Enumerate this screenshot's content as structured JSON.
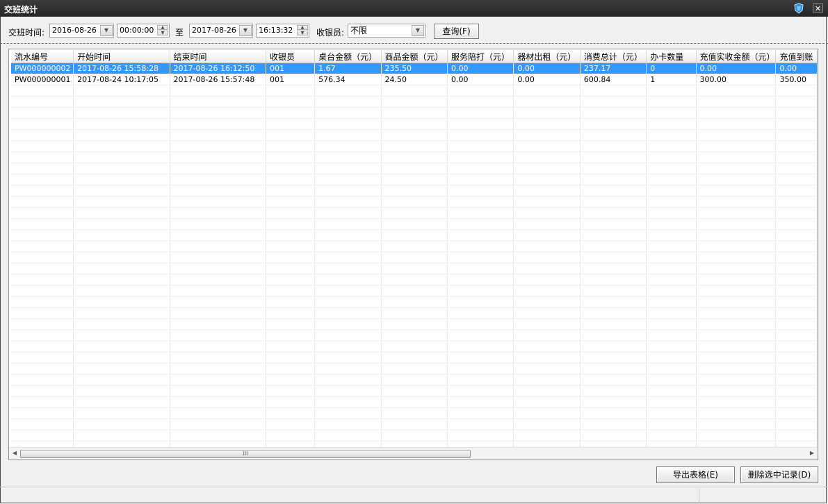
{
  "window": {
    "title": "交班统计",
    "icon": "app-shield-icon",
    "close_label": "✕"
  },
  "filters": {
    "date_label": "交班时间:",
    "start_date": "2016-08-26",
    "start_time": "00:00:00",
    "to_label": "至",
    "end_date": "2017-08-26",
    "end_time": "16:13:32",
    "cashier_label": "收银员:",
    "cashier_value": "不限",
    "query_button": "查询(F)"
  },
  "table": {
    "columns": [
      "流水编号",
      "开始时间",
      "结束时间",
      "收银员",
      "桌台金额（元）",
      "商品金额（元）",
      "服务陪打（元）",
      "器材出租（元）",
      "消费总计（元）",
      "办卡数量",
      "充值实收金额（元）",
      "充值到账"
    ],
    "rows": [
      [
        "PW000000002",
        "2017-08-26 15:58:28",
        "2017-08-26 16:12:50",
        "001",
        "1.67",
        "235.50",
        "0.00",
        "0.00",
        "237.17",
        "0",
        "0.00",
        "0.00"
      ],
      [
        "PW000000001",
        "2017-08-24 10:17:05",
        "2017-08-26 15:57:48",
        "001",
        "576.34",
        "24.50",
        "0.00",
        "0.00",
        "600.84",
        "1",
        "300.00",
        "350.00"
      ]
    ],
    "selected_row": 0
  },
  "scrollbar": {
    "thumb_grip": "III"
  },
  "actions": {
    "export_button": "导出表格(E)",
    "delete_button": "删除选中记录(D)"
  },
  "colors": {
    "titlebar": "#2e2e2e",
    "selection": "#3399ff"
  }
}
